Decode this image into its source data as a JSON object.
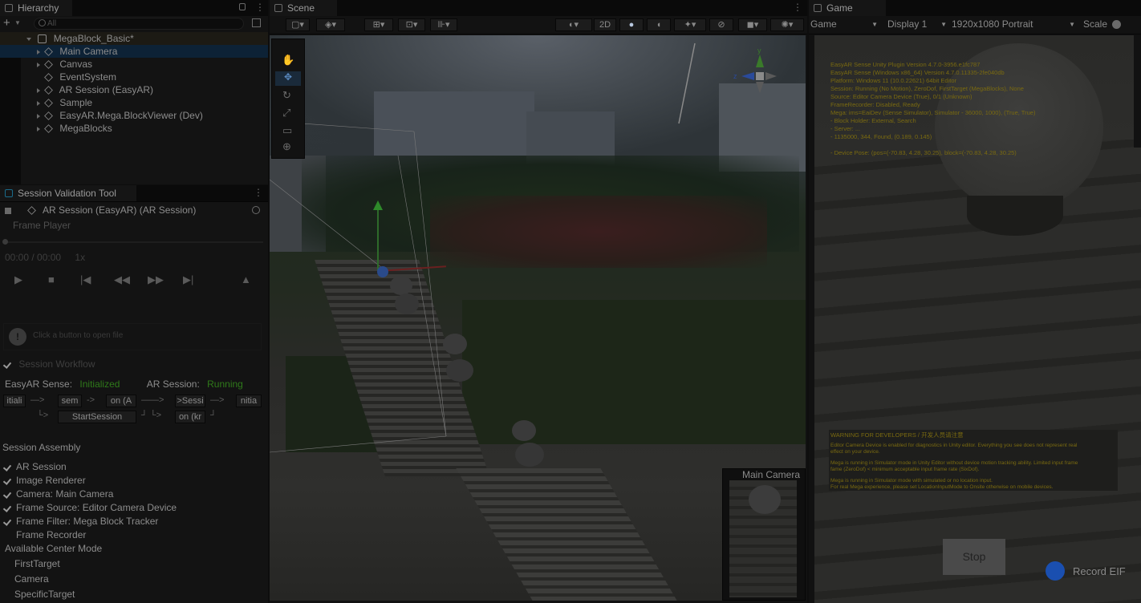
{
  "hierarchy": {
    "tab": "Hierarchy",
    "search_placeholder": "All",
    "scene_name": "MegaBlock_Basic*",
    "items": [
      {
        "label": "Main Camera"
      },
      {
        "label": "Canvas"
      },
      {
        "label": "EventSystem"
      },
      {
        "label": "AR Session (EasyAR)"
      },
      {
        "label": "Sample"
      },
      {
        "label": "EasyAR.Mega.BlockViewer (Dev)"
      },
      {
        "label": "MegaBlocks"
      }
    ]
  },
  "session_tool": {
    "tab": "Session Validation Tool",
    "session_object": "AR Session (EasyAR) (AR Session)",
    "frame_player": "Frame Player",
    "time": "00:00 / 00:00",
    "speed": "1x",
    "hint": "Click a button to open file",
    "workflow_title": "Session Workflow",
    "sense_label": "EasyAR Sense:",
    "sense_value": "Initialized",
    "session_label": "AR Session:",
    "session_value": "Running",
    "wf": {
      "b1": "itiali",
      "b2": "sem",
      "b3": "on (A",
      "b4": ">Sessi",
      "b5": "nitia",
      "start": "StartSession",
      "b6": "on (kr"
    },
    "assembly_title": "Session Assembly",
    "assembly": [
      {
        "label": "AR Session",
        "checked": true
      },
      {
        "label": "Image Renderer",
        "checked": true
      },
      {
        "label": "Camera: Main Camera",
        "checked": true
      },
      {
        "label": "Frame Source: Editor Camera Device",
        "checked": true
      },
      {
        "label": "Frame Filter: Mega Block Tracker",
        "checked": true
      },
      {
        "label": "Frame Recorder",
        "checked": false
      }
    ],
    "center_title": "Available Center Mode",
    "center_modes": [
      "FirstTarget",
      "Camera",
      "SpecificTarget"
    ]
  },
  "scene": {
    "tab": "Scene",
    "mode_2d": "2D",
    "preview_label": "Main Camera"
  },
  "game": {
    "tab": "Game",
    "display_mode": "Game",
    "display": "Display 1",
    "resolution": "1920x1080 Portrait",
    "scale_label": "Scale",
    "debug_lines": [
      "EasyAR Sense Unity Plugin Version 4.7.0-3956.e1fc787",
      "EasyAR Sense (Windows x86_64) Version 4.7.0.11335-2fe040db",
      "Platform: Windows 11 (10.0.22621) 64bit Editor",
      "Session: Running (No Motion), ZeroDof, FirstTarget (MegaBlocks), None",
      "Source: Editor Camera Device (True), 0/1 (Unknown)",
      "FrameRecorder: Disabled, Ready",
      "Mega: ims=EaiDev (Sense Simulator), Simulator - 36000, 1000), (True, True)",
      "  - Block Holder: External, Search",
      "  - Server: ...",
      "  - 1135000, 344, Found, (0.189, 0.145)",
      "",
      "  - Device Pose: (pos=(-70.83, 4.28, 30.25), block=(-70.83, 4.28, 30.25)"
    ],
    "warning_title": "WARNING FOR DEVELOPERS / 开发人员请注意",
    "warning_lines": [
      "Editor Camera Device is enabled for diagnostics in Unity editor. Everything you see does not represent real",
      "effect on your device.",
      "",
      "Mega is running in Simulator mode in Unity Editor without device motion tracking ability. Limited input frame",
      "fame (ZeroDof) < minimum acceptable input frame rate (SixDof).",
      "",
      "Mega is running in Simulator mode with simulated or no location input.",
      "For real Mega experience, please set LocationInputMode to Onsite otherwise on mobile devices."
    ],
    "stop_label": "Stop",
    "record_label": "Record EIF"
  },
  "colors": {
    "green": "#2f7a1a",
    "blue_dot": "#1a4fb0",
    "warning": "#7a6a10"
  }
}
